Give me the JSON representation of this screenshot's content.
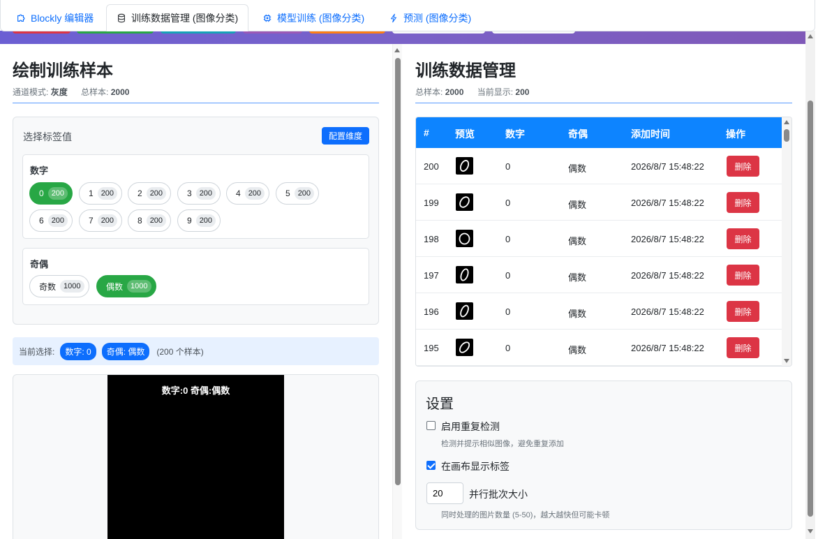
{
  "tabs": [
    {
      "label": "Blockly 编辑器",
      "icon": "puzzle-icon",
      "active": false
    },
    {
      "label": "训练数据管理 (图像分类)",
      "icon": "database-icon",
      "active": true
    },
    {
      "label": "模型训练 (图像分类)",
      "icon": "cpu-icon",
      "active": false
    },
    {
      "label": "预测 (图像分类)",
      "icon": "lightning-icon",
      "active": false
    }
  ],
  "left": {
    "title": "绘制训练样本",
    "channel_label": "通道模式:",
    "channel_value": "灰度",
    "total_label": "总样本:",
    "total_value": "2000",
    "select_title": "选择标签值",
    "config_button": "配置维度",
    "groups": [
      {
        "title": "数字",
        "chips": [
          {
            "label": "0",
            "count": "200",
            "selected": true
          },
          {
            "label": "1",
            "count": "200",
            "selected": false
          },
          {
            "label": "2",
            "count": "200",
            "selected": false
          },
          {
            "label": "3",
            "count": "200",
            "selected": false
          },
          {
            "label": "4",
            "count": "200",
            "selected": false
          },
          {
            "label": "5",
            "count": "200",
            "selected": false
          },
          {
            "label": "6",
            "count": "200",
            "selected": false
          },
          {
            "label": "7",
            "count": "200",
            "selected": false
          },
          {
            "label": "8",
            "count": "200",
            "selected": false
          },
          {
            "label": "9",
            "count": "200",
            "selected": false
          }
        ]
      },
      {
        "title": "奇偶",
        "chips": [
          {
            "label": "奇数",
            "count": "1000",
            "selected": false
          },
          {
            "label": "偶数",
            "count": "1000",
            "selected": true
          }
        ]
      }
    ],
    "current_label": "当前选择:",
    "current_badges": [
      "数字: 0",
      "奇偶: 偶数"
    ],
    "current_count": "(200 个样本)",
    "canvas_label": "数字:0 奇偶:偶数"
  },
  "right": {
    "title": "训练数据管理",
    "total_label": "总样本:",
    "total_value": "2000",
    "shown_label": "当前显示:",
    "shown_value": "200",
    "columns": [
      "#",
      "预览",
      "数字",
      "奇偶",
      "添加时间",
      "操作"
    ],
    "rows": [
      {
        "id": "200",
        "digit": "0",
        "parity": "偶数",
        "time": "2026/8/7 15:48:22",
        "action": "删除"
      },
      {
        "id": "199",
        "digit": "0",
        "parity": "偶数",
        "time": "2026/8/7 15:48:22",
        "action": "删除"
      },
      {
        "id": "198",
        "digit": "0",
        "parity": "偶数",
        "time": "2026/8/7 15:48:22",
        "action": "删除"
      },
      {
        "id": "197",
        "digit": "0",
        "parity": "偶数",
        "time": "2026/8/7 15:48:22",
        "action": "删除"
      },
      {
        "id": "196",
        "digit": "0",
        "parity": "偶数",
        "time": "2026/8/7 15:48:22",
        "action": "删除"
      },
      {
        "id": "195",
        "digit": "0",
        "parity": "偶数",
        "time": "2026/8/7 15:48:22",
        "action": "删除"
      }
    ],
    "settings": {
      "title": "设置",
      "dup_label": "启用重复检测",
      "dup_checked": false,
      "dup_hint": "检测并提示相似图像，避免重复添加",
      "show_label": "在画布显示标签",
      "show_checked": true,
      "batch_value": "20",
      "batch_label": "并行批次大小",
      "batch_hint": "同时处理的图片数量 (5-50)，越大越快但可能卡顿"
    }
  },
  "colors": {
    "primary": "#0d6efd",
    "success": "#28a745",
    "danger": "#dc3545",
    "table_header": "#0d84ff"
  }
}
